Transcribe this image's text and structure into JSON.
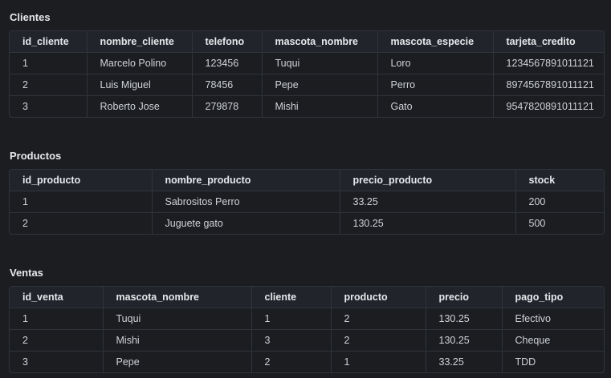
{
  "clientes": {
    "title": "Clientes",
    "columns": [
      "id_cliente",
      "nombre_cliente",
      "telefono",
      "mascota_nombre",
      "mascota_especie",
      "tarjeta_credito"
    ],
    "rows": [
      [
        "1",
        "Marcelo Polino",
        "123456",
        "Tuqui",
        "Loro",
        "1234567891011121"
      ],
      [
        "2",
        "Luis Miguel",
        "78456",
        "Pepe",
        "Perro",
        "8974567891011121"
      ],
      [
        "3",
        "Roberto Jose",
        "279878",
        "Mishi",
        "Gato",
        "9547820891011121"
      ]
    ]
  },
  "productos": {
    "title": "Productos",
    "columns": [
      "id_producto",
      "nombre_producto",
      "precio_producto",
      "stock"
    ],
    "rows": [
      [
        "1",
        "Sabrositos Perro",
        "33.25",
        "200"
      ],
      [
        "2",
        "Juguete gato",
        "130.25",
        "500"
      ]
    ]
  },
  "ventas": {
    "title": "Ventas",
    "columns": [
      "id_venta",
      "mascota_nombre",
      "cliente",
      "producto",
      "precio",
      "pago_tipo"
    ],
    "rows": [
      [
        "1",
        "Tuqui",
        "1",
        "2",
        "130.25",
        "Efectivo"
      ],
      [
        "2",
        "Mishi",
        "3",
        "2",
        "130.25",
        "Cheque"
      ],
      [
        "3",
        "Pepe",
        "2",
        "1",
        "33.25",
        "TDD"
      ]
    ]
  }
}
